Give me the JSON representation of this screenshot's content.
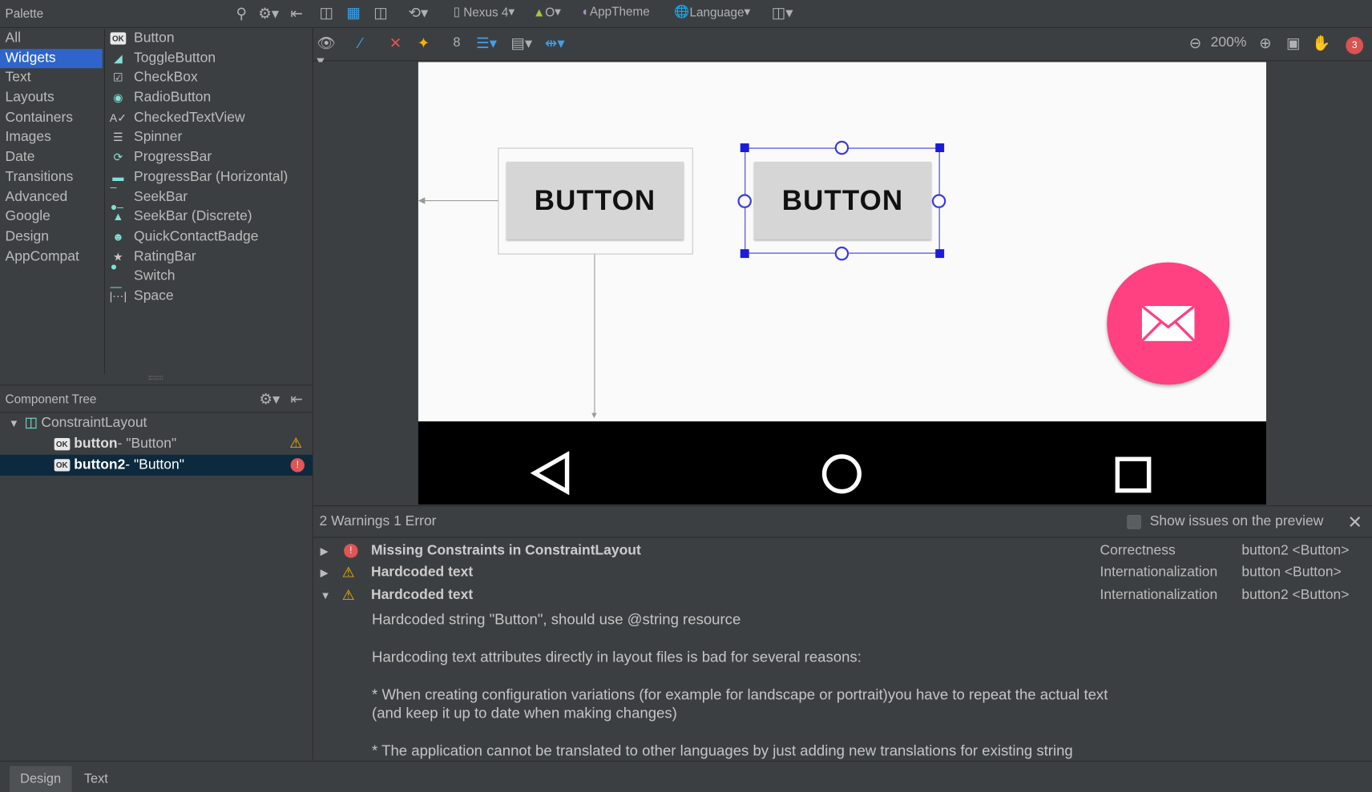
{
  "palette": {
    "title": "Palette",
    "categories": [
      "All",
      "Widgets",
      "Text",
      "Layouts",
      "Containers",
      "Images",
      "Date",
      "Transitions",
      "Advanced",
      "Google",
      "Design",
      "AppCompat"
    ],
    "selected_category": "Widgets",
    "widgets": [
      {
        "label": "Button",
        "icon": "ok-icon"
      },
      {
        "label": "ToggleButton",
        "icon": "toggle-icon"
      },
      {
        "label": "CheckBox",
        "icon": "checkbox-icon"
      },
      {
        "label": "RadioButton",
        "icon": "radio-icon"
      },
      {
        "label": "CheckedTextView",
        "icon": "checked-text-icon"
      },
      {
        "label": "Spinner",
        "icon": "spinner-icon"
      },
      {
        "label": "ProgressBar",
        "icon": "progress-icon"
      },
      {
        "label": "ProgressBar (Horizontal)",
        "icon": "progress-horizontal-icon"
      },
      {
        "label": "SeekBar",
        "icon": "seekbar-icon"
      },
      {
        "label": "SeekBar (Discrete)",
        "icon": "seekbar-discrete-icon"
      },
      {
        "label": "QuickContactBadge",
        "icon": "contact-icon"
      },
      {
        "label": "RatingBar",
        "icon": "star-icon"
      },
      {
        "label": "Switch",
        "icon": "switch-icon"
      },
      {
        "label": "Space",
        "icon": "space-icon"
      }
    ]
  },
  "toolbar": {
    "device": "Nexus 4",
    "api": "O",
    "theme": "AppTheme",
    "language": "Language",
    "margin": "8",
    "zoom": "200%",
    "error_count": "3"
  },
  "component_tree": {
    "title": "Component Tree",
    "root": "ConstraintLayout",
    "items": [
      {
        "id": "button",
        "text": " - \"Button\"",
        "status": "warning"
      },
      {
        "id": "button2",
        "text": " - \"Button\"",
        "status": "error",
        "selected": true
      }
    ]
  },
  "preview": {
    "button1_label": "BUTTON",
    "button2_label": "BUTTON",
    "fab_color": "#ff4081",
    "selection_color": "#1b1bd8"
  },
  "issues": {
    "summary": "2 Warnings 1 Error",
    "show_on_preview_label": "Show issues on the preview",
    "show_on_preview_checked": false,
    "rows": [
      {
        "severity": "error",
        "title": "Missing Constraints in ConstraintLayout",
        "category": "Correctness",
        "component": "button2 <Button>",
        "expanded": false
      },
      {
        "severity": "warning",
        "title": "Hardcoded text",
        "category": "Internationalization",
        "component": "button <Button>",
        "expanded": false
      },
      {
        "severity": "warning",
        "title": "Hardcoded text",
        "category": "Internationalization",
        "component": "button2 <Button>",
        "expanded": true
      }
    ],
    "details": [
      "Hardcoded string \"Button\", should use @string resource",
      "Hardcoding text attributes directly in layout files is bad for several reasons:",
      "* When creating configuration variations (for example for landscape or portrait)you have to repeat the actual text",
      "(and keep it up to date when making changes)",
      "* The application cannot be translated to other languages by just adding new translations for existing string"
    ]
  },
  "bottom_tabs": [
    "Design",
    "Text"
  ],
  "selected_tab": "Design"
}
